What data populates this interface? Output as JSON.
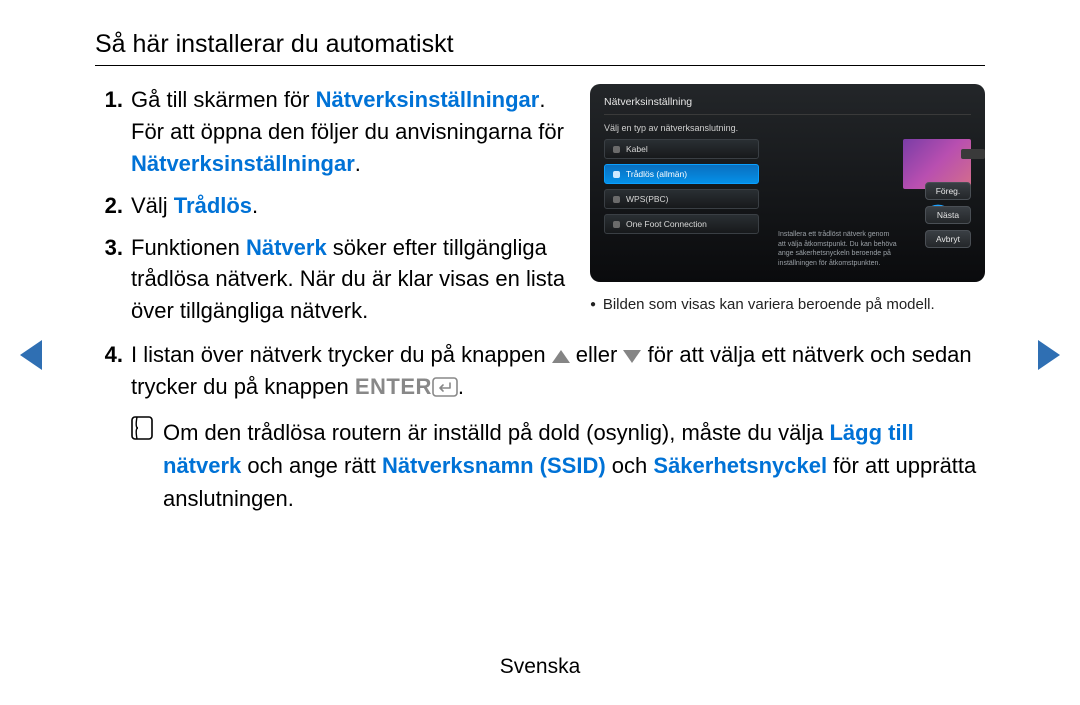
{
  "heading": "Så här installerar du automatiskt",
  "steps": {
    "s1a": "Gå till skärmen för ",
    "s1b": "Nätverksinställningar",
    "s1c": ". För att öppna den följer du anvisningarna för ",
    "s1d": "Nätverksinställningar",
    "s1e": ".",
    "s2a": "Välj ",
    "s2b": "Trådlös",
    "s2c": ".",
    "s3a": "Funktionen ",
    "s3b": "Nätverk",
    "s3c": " söker efter tillgängliga trådlösa nätverk. När du är klar visas en lista över tillgängliga nätverk.",
    "s4a": "I listan över nätverk trycker du på knappen ",
    "s4b": " eller ",
    "s4c": " för att välja ett nätverk och sedan trycker du på knappen ",
    "s4d": "ENTER",
    "s4e": "."
  },
  "note": {
    "a": "Om den trådlösa routern är inställd på dold (osynlig), måste du välja ",
    "b": "Lägg till nätverk",
    "c": " och ange rätt  ",
    "d": "Nätverksnamn (SSID)",
    "e": " och ",
    "f": "Säkerhetsnyckel",
    "g": " för att upprätta anslutningen."
  },
  "screenshot": {
    "title": "Nätverksinställning",
    "prompt": "Välj en typ av nätverksanslutning.",
    "options": [
      "Kabel",
      "Trådlös (allmän)",
      "WPS(PBC)",
      "One Foot Connection"
    ],
    "help": "Installera ett trådlöst nätverk genom att välja åtkomstpunkt. Du kan behöva ange säkerhetsnyckeln beroende på inställningen för åtkomstpunkten.",
    "buttons": [
      "Föreg.",
      "Nästa",
      "Avbryt"
    ]
  },
  "caption": "Bilden som visas kan variera beroende på modell.",
  "footer": "Svenska"
}
